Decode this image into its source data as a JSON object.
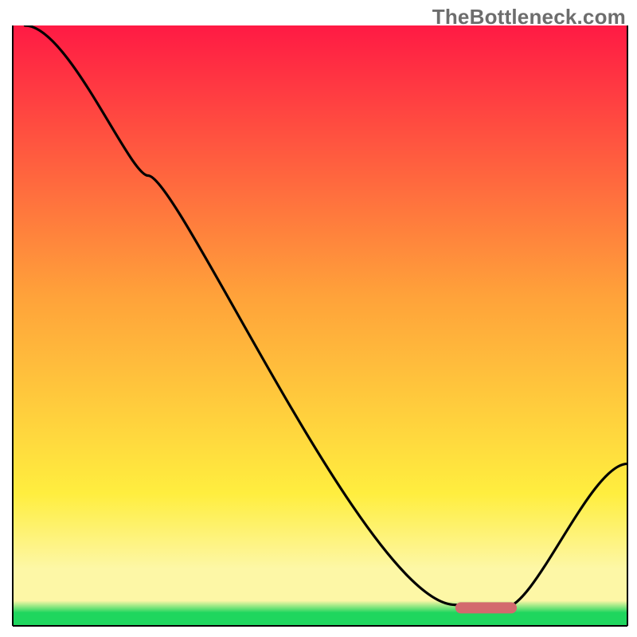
{
  "watermark": "TheBottleneck.com",
  "colors": {
    "top_red": "#ff1a44",
    "mid_orange": "#ffa23a",
    "yellow": "#ffee3f",
    "pale_yellow": "#fdf7a6",
    "green": "#1fd65e",
    "curve": "#000000",
    "lozenge": "#d36a6e",
    "axis": "#000000"
  },
  "chart_data": {
    "type": "line",
    "title": "",
    "xlabel": "",
    "ylabel": "",
    "ylim": [
      0,
      100
    ],
    "xlim": [
      0,
      100
    ],
    "x": [
      2,
      22,
      72,
      75,
      80,
      100
    ],
    "values": [
      100,
      75,
      3.5,
      2.5,
      3,
      27
    ],
    "marker": {
      "x_start": 72,
      "x_end": 82,
      "y": 3
    }
  }
}
